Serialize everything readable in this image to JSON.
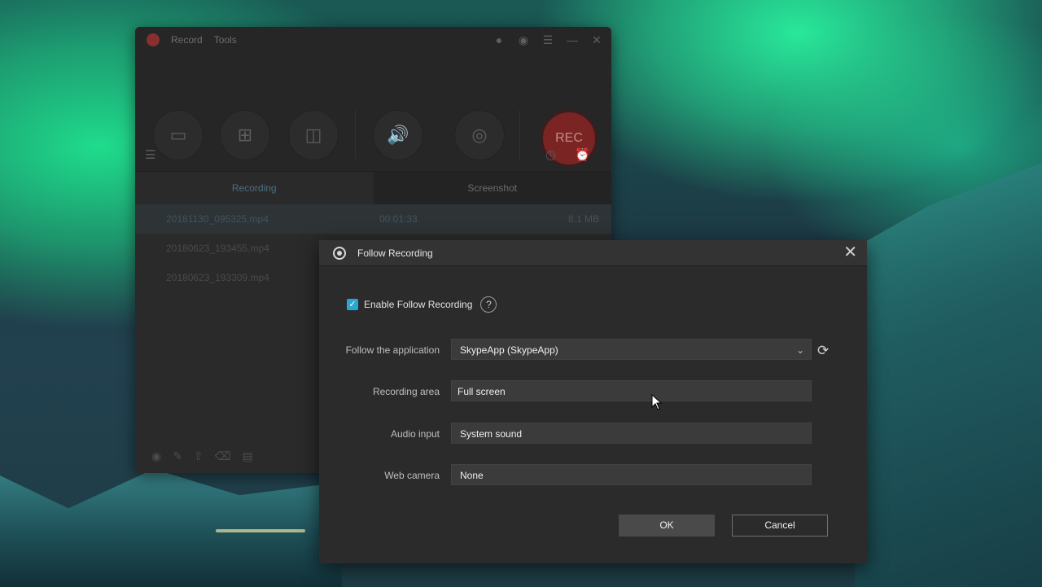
{
  "app": {
    "menu": [
      "Record",
      "Tools"
    ],
    "rec_label": "REC",
    "tabs": [
      "Recording",
      "Screenshot"
    ],
    "files": [
      {
        "name": "20181130_095325.mp4",
        "duration": "00:01:33",
        "size": "8.1 MB"
      },
      {
        "name": "20180623_193455.mp4",
        "duration": "",
        "size": ""
      },
      {
        "name": "20180623_193309.mp4",
        "duration": "",
        "size": ""
      }
    ]
  },
  "dialog": {
    "title": "Follow Recording",
    "enable_label": "Enable Follow Recording",
    "enable_checked": true,
    "help_glyph": "?",
    "fields": {
      "application": {
        "label": "Follow the application",
        "value": "SkypeApp (SkypeApp)"
      },
      "area": {
        "label": "Recording area",
        "value": "Full screen"
      },
      "audio": {
        "label": "Audio input",
        "value": "System sound"
      },
      "camera": {
        "label": "Web camera",
        "value": "None"
      }
    },
    "ok_label": "OK",
    "cancel_label": "Cancel"
  },
  "colors": {
    "accent": "#2aa6d0",
    "rec": "#7a2424"
  }
}
